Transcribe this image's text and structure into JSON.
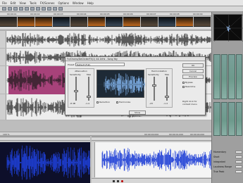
{
  "menu": {
    "items": [
      "File",
      "Edit",
      "View",
      "Tools",
      "FX/Scenes",
      "Options",
      "Window",
      "Help"
    ]
  },
  "ruler": {
    "top_ticks": [
      "00:00:01",
      "00:00:02",
      "00:00:03",
      "00:00:04",
      "00:00:05",
      "00:00:06",
      "00:00:07",
      "00:00:08",
      "00:00:09"
    ]
  },
  "dialog": {
    "title": "Fx/Chains/DeClickerFX(1) 44.1kHz - Song Yay",
    "preset_label": "Preset:",
    "preset_value": "Default (Full)",
    "left_group": "Attenuation",
    "right_group": "Harmonization",
    "left_slider_labels": [
      "Sensitivity",
      "Max"
    ],
    "left_slider_values": [
      "-8 dB",
      "-1.4"
    ],
    "right_slider_labels": [
      "Sensitivity",
      "Max"
    ],
    "right_slider_values": [
      "-23",
      "-1.4"
    ],
    "ok": "OK",
    "cancel": "Cancel",
    "preview": "Preview",
    "bypass": "Bypass",
    "real_time": "Real-time",
    "hint": "Right click for context menu",
    "more_options": "Show Options...",
    "checkbox_left": "Reduction",
    "checkbox_right": "Harmonize"
  },
  "status": {
    "zoom": "100 %",
    "left_time": "00:00:00.000",
    "mid_time": "00:00:01.000",
    "right_time": "00:00:04.000"
  },
  "stats_panel": {
    "labels": [
      "Momentary",
      "Short",
      "Integrated",
      "Loudness Range",
      "True Peak"
    ]
  },
  "colors": {
    "selection": "#a7427a",
    "wave": "#1a1a1a",
    "blue_wave": "#1f3fd6",
    "dialog_bg": "#eaeaea"
  }
}
